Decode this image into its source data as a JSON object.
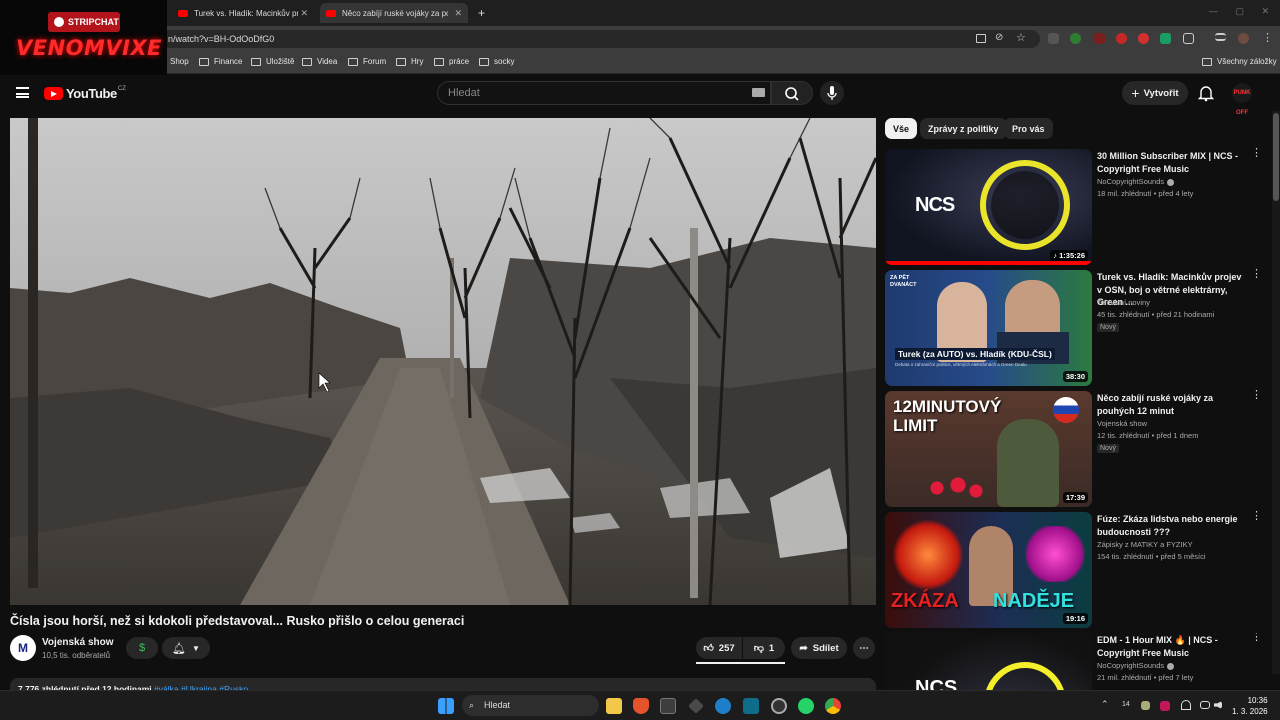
{
  "browser": {
    "tabs": [
      {
        "title": "Turek vs. Hladík: Macinkův proje"
      },
      {
        "title": "Něco zabíjí ruské vojáky za pou"
      }
    ],
    "new_tab": "+",
    "url": "n/watch?v=BH-OdOoDfG0",
    "bookmarks": [
      "Shop",
      "Finance",
      "Uložiště",
      "Videa",
      "Forum",
      "Hry",
      "práce",
      "socky"
    ],
    "all_bookmarks": "Všechny záložky"
  },
  "overlay": {
    "badge": "STRIPCHAT",
    "name": "VENOMVIXE"
  },
  "youtube": {
    "logo_text": "YouTube",
    "logo_country": "CZ",
    "search_placeholder": "Hledat",
    "create_label": "Vytvořit",
    "avatar_text": "PUNK OFF"
  },
  "video": {
    "title": "Čísla jsou horší, než si kdokoli představoval... Rusko přišlo o celou generaci",
    "channel": "Vojenská show",
    "channel_initial": "M",
    "subscribers": "10,5 tis. odběratelů",
    "likes": "257",
    "dislikes": "1",
    "share_label": "Sdílet",
    "description_meta": "7 776 zhlédnutí  před 12 hodinami",
    "description_tags": "#válka #Ukrajina #Rusko"
  },
  "chips": [
    {
      "label": "Vše",
      "active": true
    },
    {
      "label": "Zprávy z politiky",
      "active": false
    },
    {
      "label": "Pro vás",
      "active": false
    }
  ],
  "recommendations": [
    {
      "title": "30 Million Subscriber MIX | NCS - Copyright Free Music",
      "channel": "NoCopyrightSounds",
      "verified": true,
      "meta": "18 mil. zhlédnutí • před 4 lety",
      "duration": "1:35:26",
      "thumb_text": "NCS",
      "is_new": false
    },
    {
      "title": "Turek vs. Hladík: Macinkův projev v OSN, boj o větrné elektrárny, Green ...",
      "channel": "Televizní noviny",
      "verified": false,
      "meta": "45 tis. zhlédnutí • před 21 hodinami",
      "duration": "38:30",
      "thumb_text": "Turek (za AUTO) vs. Hladík (KDU-ČSL)",
      "thumb_sub": "Debata o zahraniční politice, větrných elektrárnách a Green Dealu",
      "thumb_corner": "ZA PĚT DVANÁCT",
      "is_new": true,
      "new_label": "Nový"
    },
    {
      "title": "Něco zabíjí ruské vojáky za pouhých 12 minut",
      "channel": "Vojenská show",
      "verified": false,
      "meta": "12 tis. zhlédnutí • před 1 dnem",
      "duration": "17:39",
      "thumb_text": "12MINUTOVÝ LIMIT",
      "is_new": true,
      "new_label": "Nový"
    },
    {
      "title": "Fúze: Zkáza lidstva nebo energie budoucnosti ???",
      "channel": "Zápisky z MATIKY a FYZIKY",
      "verified": false,
      "meta": "154 tis. zhlédnutí • před 5 měsíci",
      "duration": "19:16",
      "thumb_text_left": "ZKÁZA",
      "thumb_text_right": "NADĚJE",
      "is_new": false
    },
    {
      "title": "EDM - 1 Hour MIX 🔥 | NCS - Copyright Free Music",
      "channel": "NoCopyrightSounds",
      "verified": true,
      "meta": "21 mil. zhlédnutí • před 7 lety",
      "duration": "",
      "thumb_text": "NCS",
      "is_new": false
    }
  ],
  "taskbar": {
    "search_label": "Hledat",
    "time": "10:36",
    "date": "1. 3. 2026",
    "tray_num": "14"
  },
  "colors": {
    "youtube_red": "#ff0000",
    "bg": "#0f0f0f",
    "link_blue": "#3ea6ff"
  }
}
